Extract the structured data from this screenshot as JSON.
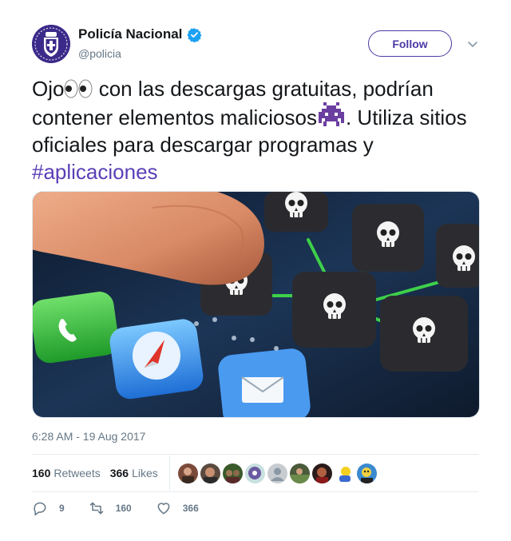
{
  "account": {
    "name": "Policía Nacional",
    "handle": "@policia",
    "verified": true,
    "follow_label": "Follow"
  },
  "tweet": {
    "text_part1": "Ojo",
    "text_part2": " con las descargas gratuitas, podrían contener elementos maliciosos",
    "text_part3": ". Utiliza sitios oficiales para descargar programas y ",
    "hashtag": "#aplicaciones",
    "emojis": [
      "eyes-emoji",
      "alien-monster-emoji"
    ],
    "timestamp": "6:28 AM - 19 Aug 2017"
  },
  "stats": {
    "retweets_count": "160",
    "retweets_label": "Retweets",
    "likes_count": "366",
    "likes_label": "Likes",
    "liker_avatars": 9
  },
  "actions": {
    "reply_count": "9",
    "retweet_count": "160",
    "like_count": "366"
  },
  "colors": {
    "brand": "#4a3aa5",
    "hashtag": "#5a3fb7",
    "verified": "#1da1f2",
    "muted": "#657786"
  }
}
